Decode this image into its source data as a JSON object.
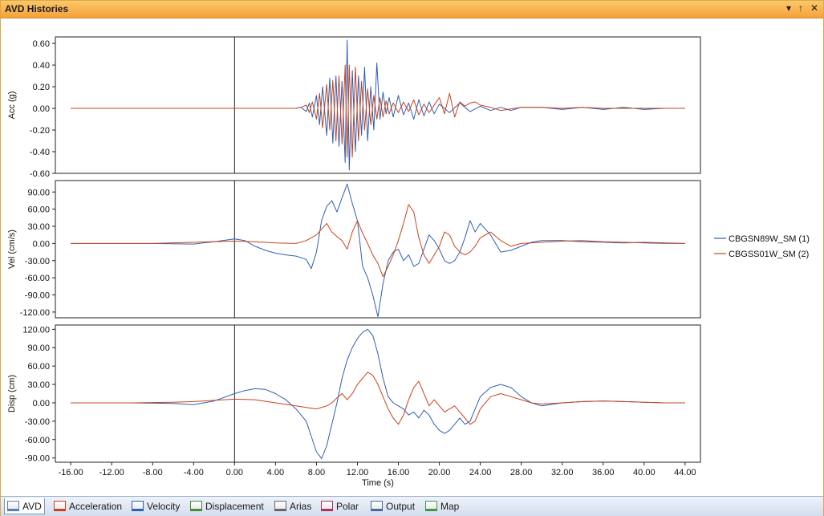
{
  "window": {
    "title": "AVD Histories",
    "pin_glyph": "▾",
    "dock_glyph": "↑",
    "close_glyph": "✕"
  },
  "tabs": [
    {
      "label": "AVD",
      "icon": "avd-icon",
      "active": true
    },
    {
      "label": "Acceleration",
      "icon": "acceleration-icon",
      "active": false
    },
    {
      "label": "Velocity",
      "icon": "velocity-icon",
      "active": false
    },
    {
      "label": "Displacement",
      "icon": "displacement-icon",
      "active": false
    },
    {
      "label": "Arias",
      "icon": "arias-icon",
      "active": false
    },
    {
      "label": "Polar",
      "icon": "polar-icon",
      "active": false
    },
    {
      "label": "Output",
      "icon": "output-icon",
      "active": false
    },
    {
      "label": "Map",
      "icon": "map-icon",
      "active": false
    }
  ],
  "chart_data": {
    "type": "line",
    "xlabel": "Time (s)",
    "xlim": [
      -17.5,
      45.5
    ],
    "xticks": [
      -16,
      -12,
      -8,
      -4,
      0,
      4,
      8,
      12,
      16,
      20,
      24,
      28,
      32,
      36,
      40,
      44
    ],
    "xtick_labels": [
      "-16.00",
      "-12.00",
      "-8.00",
      "-4.00",
      "0.00",
      "4.00",
      "8.00",
      "12.00",
      "16.00",
      "20.00",
      "24.00",
      "28.00",
      "32.00",
      "36.00",
      "40.00",
      "44.00"
    ],
    "zero_line_x": 0,
    "legend": {
      "placement": "right",
      "entries": [
        {
          "name": "CBGSN89W_SM (1)",
          "color": "#2f5fb3"
        },
        {
          "name": "CBGSS01W_SM (2)",
          "color": "#c8431c"
        }
      ]
    },
    "panels": [
      {
        "ylabel": "Acc (g)",
        "ylim": [
          -0.6,
          0.66
        ],
        "yticks": [
          0.6,
          0.4,
          0.2,
          0,
          -0.2,
          -0.4,
          -0.6
        ],
        "ytick_labels": [
          "0.60",
          "0.40",
          "0.20",
          "0.00",
          "-0.20",
          "-0.40",
          "-0.60"
        ],
        "series": [
          {
            "name": "CBGSN89W_SM (1)",
            "color": "#2f5fb3",
            "x": [
              -16,
              0,
              6,
              6.5,
              7,
              7.3,
              7.6,
              8,
              8.3,
              8.6,
              9,
              9.3,
              9.6,
              9.9,
              10.2,
              10.5,
              10.8,
              11,
              11.2,
              11.5,
              11.8,
              12.1,
              12.4,
              12.7,
              13,
              13.3,
              13.6,
              13.9,
              14.2,
              14.5,
              14.8,
              15.1,
              15.5,
              16,
              16.5,
              17,
              17.5,
              18,
              18.5,
              19,
              19.5,
              20,
              21,
              22,
              23,
              24,
              25,
              26,
              27,
              28,
              30,
              32,
              34,
              36,
              38,
              40,
              42,
              44
            ],
            "y": [
              0,
              0,
              0,
              0.01,
              -0.03,
              0.05,
              -0.08,
              0.12,
              -0.15,
              0.2,
              -0.25,
              0.28,
              -0.32,
              0.3,
              -0.35,
              0.25,
              -0.5,
              0.63,
              -0.57,
              0.35,
              -0.4,
              0.3,
              -0.25,
              0.38,
              -0.3,
              0.2,
              -0.2,
              0.42,
              -0.1,
              0.15,
              -0.05,
              0.1,
              -0.08,
              0.12,
              -0.06,
              0.05,
              -0.1,
              0.08,
              -0.07,
              0.06,
              -0.05,
              0.04,
              -0.04,
              0.05,
              -0.03,
              0.02,
              -0.02,
              0.01,
              -0.02,
              0.01,
              0.01,
              -0.01,
              0.01,
              -0.01,
              0.01,
              -0.01,
              0,
              0
            ]
          },
          {
            "name": "CBGSS01W_SM (2)",
            "color": "#c8431c",
            "x": [
              -16,
              0,
              6,
              6.5,
              7,
              7.3,
              7.6,
              8,
              8.3,
              8.6,
              9,
              9.3,
              9.6,
              9.9,
              10.2,
              10.5,
              10.8,
              11,
              11.2,
              11.5,
              11.8,
              12.1,
              12.4,
              12.7,
              13,
              13.3,
              13.6,
              13.9,
              14.2,
              14.5,
              14.8,
              15.1,
              15.5,
              16,
              16.5,
              17,
              17.5,
              18,
              18.5,
              19,
              19.5,
              20,
              20.5,
              21,
              21.5,
              22,
              22.5,
              23,
              23.5,
              24,
              25,
              26,
              28,
              30,
              32,
              34,
              36,
              38,
              40,
              42,
              44
            ],
            "y": [
              0,
              0,
              0,
              0.01,
              0.03,
              -0.04,
              0.06,
              -0.1,
              0.14,
              -0.18,
              0.22,
              -0.2,
              0.26,
              -0.3,
              0.3,
              -0.33,
              0.4,
              -0.45,
              0.4,
              -0.45,
              0.38,
              -0.3,
              0.25,
              -0.2,
              0.18,
              -0.15,
              0.12,
              -0.1,
              0.1,
              -0.08,
              0.07,
              -0.05,
              0.05,
              -0.04,
              0.06,
              -0.03,
              0.08,
              -0.06,
              0.04,
              -0.04,
              0.03,
              0.1,
              -0.05,
              0.14,
              -0.08,
              0.06,
              0.02,
              0.05,
              0.06,
              0.03,
              0.01,
              -0.02,
              0.01,
              0.01,
              0,
              0.01,
              0,
              0,
              0,
              0,
              0
            ]
          }
        ]
      },
      {
        "ylabel": "Vel (cm/s)",
        "ylim": [
          -130,
          110
        ],
        "yticks": [
          90,
          60,
          30,
          0,
          -30,
          -60,
          -90,
          -120
        ],
        "ytick_labels": [
          "90.00",
          "60.00",
          "30.00",
          "0.00",
          "-30.00",
          "-60.00",
          "-90.00",
          "-120.00"
        ],
        "series": [
          {
            "name": "CBGSN89W_SM (1)",
            "color": "#2f5fb3",
            "x": [
              -16,
              -8,
              -4,
              -2,
              0,
              1,
              2,
              3,
              4,
              5,
              6,
              7,
              7.5,
              8,
              8.5,
              9,
              9.5,
              10,
              10.5,
              11,
              11.5,
              12,
              12.5,
              13,
              13.5,
              14,
              14.5,
              15,
              15.5,
              16,
              16.5,
              17,
              17.5,
              18,
              18.5,
              19,
              19.5,
              20,
              20.5,
              21,
              21.5,
              22,
              22.5,
              23,
              23.5,
              24,
              25,
              26,
              27,
              28,
              29,
              30,
              32,
              34,
              36,
              38,
              40,
              42,
              44
            ],
            "y": [
              0,
              0,
              -1,
              3,
              8,
              5,
              -5,
              -12,
              -17,
              -20,
              -22,
              -28,
              -44,
              -15,
              40,
              65,
              75,
              55,
              80,
              104,
              70,
              40,
              -40,
              -60,
              -90,
              -128,
              -70,
              -30,
              -15,
              -10,
              -30,
              -20,
              -40,
              -35,
              -10,
              15,
              5,
              -10,
              -30,
              -35,
              -30,
              -15,
              10,
              40,
              20,
              35,
              15,
              -15,
              -12,
              -5,
              2,
              5,
              5,
              3,
              2,
              1,
              2,
              1,
              0
            ]
          },
          {
            "name": "CBGSS01W_SM (2)",
            "color": "#c8431c",
            "x": [
              -16,
              -8,
              -4,
              0,
              2,
              4,
              6,
              7,
              8,
              8.5,
              9,
              9.5,
              10,
              10.5,
              11,
              11.5,
              12,
              12.5,
              13,
              13.5,
              14,
              14.5,
              15,
              15.5,
              16,
              16.5,
              17,
              17.5,
              18,
              18.5,
              19,
              19.5,
              20,
              20.5,
              21,
              21.5,
              22,
              22.5,
              23,
              23.5,
              24,
              25,
              26,
              27,
              28,
              30,
              32,
              34,
              36,
              38,
              40,
              42,
              44
            ],
            "y": [
              0,
              0,
              2,
              4,
              3,
              1,
              0,
              5,
              15,
              25,
              35,
              20,
              12,
              5,
              -10,
              20,
              40,
              18,
              0,
              -20,
              -35,
              -58,
              -40,
              -20,
              5,
              35,
              68,
              55,
              10,
              -20,
              -35,
              -20,
              -5,
              20,
              15,
              -5,
              -15,
              -20,
              -15,
              -5,
              10,
              20,
              5,
              -5,
              0,
              2,
              4,
              5,
              3,
              2,
              1,
              0,
              0
            ]
          }
        ]
      },
      {
        "ylabel": "Disp (cm)",
        "ylim": [
          -97,
          127
        ],
        "yticks": [
          120,
          90,
          60,
          30,
          0,
          -30,
          -60,
          -90
        ],
        "ytick_labels": [
          "120.00",
          "90.00",
          "60.00",
          "30.00",
          "0.00",
          "-30.00",
          "-60.00",
          "-90.00"
        ],
        "series": [
          {
            "name": "CBGSN89W_SM (1)",
            "color": "#2f5fb3",
            "x": [
              -16,
              -10,
              -6,
              -4,
              -2,
              0,
              1,
              2,
              3,
              4,
              5,
              6,
              7,
              7.5,
              8,
              8.5,
              9,
              9.5,
              10,
              10.5,
              11,
              11.5,
              12,
              12.5,
              13,
              13.5,
              14,
              14.5,
              15,
              15.5,
              16,
              16.5,
              17,
              17.5,
              18,
              18.5,
              19,
              19.5,
              20,
              20.5,
              21,
              21.5,
              22,
              22.5,
              23,
              23.5,
              24,
              25,
              26,
              27,
              28,
              29,
              30,
              32,
              34,
              36,
              38,
              40,
              42,
              44
            ],
            "y": [
              0,
              0,
              -1,
              -3,
              3,
              15,
              20,
              23,
              22,
              15,
              5,
              -10,
              -30,
              -55,
              -80,
              -91,
              -70,
              -35,
              0,
              40,
              70,
              90,
              105,
              115,
              120,
              110,
              80,
              40,
              10,
              0,
              -5,
              -10,
              -20,
              -15,
              -25,
              -12,
              -20,
              -35,
              -45,
              -50,
              -45,
              -35,
              -25,
              -35,
              -30,
              -10,
              10,
              25,
              30,
              25,
              10,
              0,
              -5,
              0,
              2,
              3,
              2,
              1,
              0,
              0
            ]
          },
          {
            "name": "CBGSS01W_SM (2)",
            "color": "#c8431c",
            "x": [
              -16,
              -10,
              -6,
              -4,
              -2,
              0,
              2,
              4,
              6,
              8,
              9,
              9.5,
              10,
              10.5,
              11,
              11.5,
              12,
              12.5,
              13,
              13.5,
              14,
              14.5,
              15,
              15.5,
              16,
              16.5,
              17,
              17.5,
              18,
              18.5,
              19,
              19.5,
              20,
              20.5,
              21,
              21.5,
              22,
              22.5,
              23,
              23.5,
              24,
              25,
              26,
              27,
              28,
              29,
              30,
              32,
              34,
              36,
              38,
              40,
              42,
              44
            ],
            "y": [
              0,
              0,
              1,
              2,
              4,
              6,
              5,
              0,
              -5,
              -10,
              -5,
              0,
              8,
              15,
              5,
              15,
              30,
              40,
              50,
              45,
              30,
              10,
              -10,
              -25,
              -35,
              -20,
              5,
              25,
              35,
              15,
              -5,
              5,
              -5,
              -15,
              -10,
              -5,
              -15,
              -25,
              -35,
              -30,
              -10,
              10,
              15,
              10,
              5,
              0,
              -2,
              0,
              2,
              3,
              2,
              1,
              0,
              0
            ]
          }
        ]
      }
    ]
  }
}
